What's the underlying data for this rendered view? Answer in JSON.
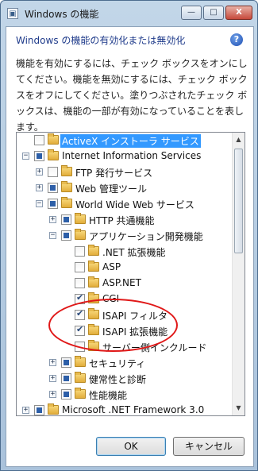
{
  "window": {
    "title": "Windows の機能",
    "heading": "Windows の機能の有効化または無効化",
    "description": "機能を有効にするには、チェック ボックスをオンにしてください。機能を無効にするには、チェック ボックスをオフにしてください。塗りつぶされたチェック ボックスは、機能の一部が有効になっていることを表します。",
    "caption_buttons": {
      "minimize": "—",
      "maximize": "□",
      "close": "X"
    }
  },
  "icons": {
    "help": "?",
    "expand": "+",
    "collapse": "−",
    "scroll_up": "▲",
    "scroll_down": "▼"
  },
  "tree": [
    {
      "label": "ActiveX インストーラ サービス",
      "state": "unchecked",
      "expander": "none",
      "level": 0,
      "selected": true
    },
    {
      "label": "Internet Information Services",
      "state": "partial",
      "expander": "collapse",
      "level": 0
    },
    {
      "label": "FTP 発行サービス",
      "state": "unchecked",
      "expander": "expand",
      "level": 1
    },
    {
      "label": "Web 管理ツール",
      "state": "partial",
      "expander": "expand",
      "level": 1
    },
    {
      "label": "World Wide Web サービス",
      "state": "partial",
      "expander": "collapse",
      "level": 1
    },
    {
      "label": "HTTP 共通機能",
      "state": "partial",
      "expander": "expand",
      "level": 2
    },
    {
      "label": "アプリケーション開発機能",
      "state": "partial",
      "expander": "collapse",
      "level": 2
    },
    {
      "label": ".NET 拡張機能",
      "state": "unchecked",
      "expander": "none",
      "level": 3
    },
    {
      "label": "ASP",
      "state": "unchecked",
      "expander": "none",
      "level": 3
    },
    {
      "label": "ASP.NET",
      "state": "unchecked",
      "expander": "none",
      "level": 3
    },
    {
      "label": "CGI",
      "state": "checked",
      "expander": "none",
      "level": 3
    },
    {
      "label": "ISAPI フィルタ",
      "state": "checked",
      "expander": "none",
      "level": 3
    },
    {
      "label": "ISAPI 拡張機能",
      "state": "checked",
      "expander": "none",
      "level": 3
    },
    {
      "label": "サーバー側インクルード",
      "state": "unchecked",
      "expander": "none",
      "level": 3
    },
    {
      "label": "セキュリティ",
      "state": "partial",
      "expander": "expand",
      "level": 2
    },
    {
      "label": "健常性と診断",
      "state": "partial",
      "expander": "expand",
      "level": 2
    },
    {
      "label": "性能機能",
      "state": "partial",
      "expander": "expand",
      "level": 2
    },
    {
      "label": "Microsoft .NET Framework 3.0",
      "state": "partial",
      "expander": "expand",
      "level": 0
    }
  ],
  "buttons": {
    "ok": "OK",
    "cancel": "キャンセル"
  },
  "colors": {
    "highlight": "#e01818",
    "selection": "#3399ff",
    "accent": "#1e3a8a"
  }
}
